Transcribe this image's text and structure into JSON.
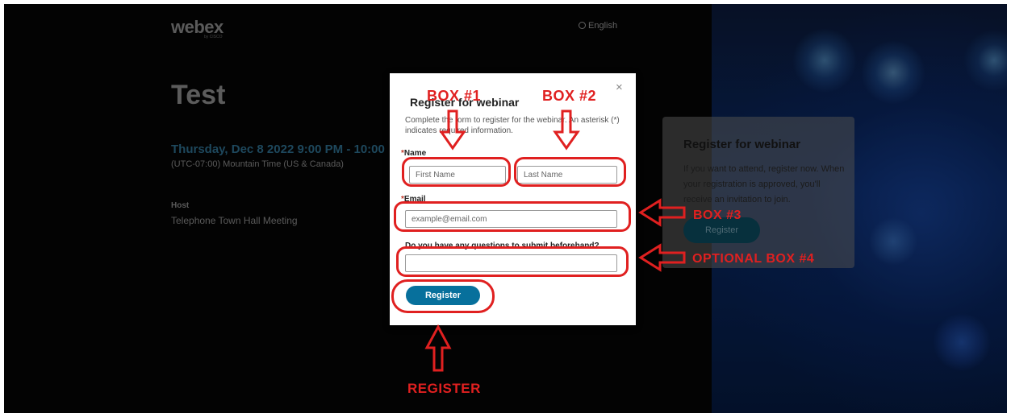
{
  "brand": {
    "name": "webex",
    "sub": "by CISCO"
  },
  "language": "English",
  "event": {
    "title": "Test",
    "date": "Thursday, Dec 8 2022 9:00 PM - 10:00",
    "timezone": "(UTC-07:00) Mountain Time (US & Canada)",
    "host_label": "Host",
    "host_name": "Telephone Town Hall Meeting"
  },
  "side_card": {
    "title": "Register for webinar",
    "text": "If you want to attend, register now. When your registration is approved, you'll receive an invitation to join.",
    "button": "Register"
  },
  "modal": {
    "close": "×",
    "title": "Register for webinar",
    "description": "Complete the form to register for the webinar. An asterisk (*) indicates required information.",
    "name_label": "Name",
    "first_placeholder": "First Name",
    "last_placeholder": "Last Name",
    "email_label": "Email",
    "email_placeholder": "example@email.com",
    "question_label": "Do you have any questions to submit beforehand?",
    "register_button": "Register",
    "required_mark": "*"
  },
  "annotations": {
    "box1": "BOX #1",
    "box2": "BOX #2",
    "box3": "BOX #3",
    "box4": "OPTIONAL BOX #4",
    "register": "REGISTER",
    "color": "#e02020"
  },
  "colors": {
    "accent": "#07709c",
    "date": "#2e6f8f"
  }
}
